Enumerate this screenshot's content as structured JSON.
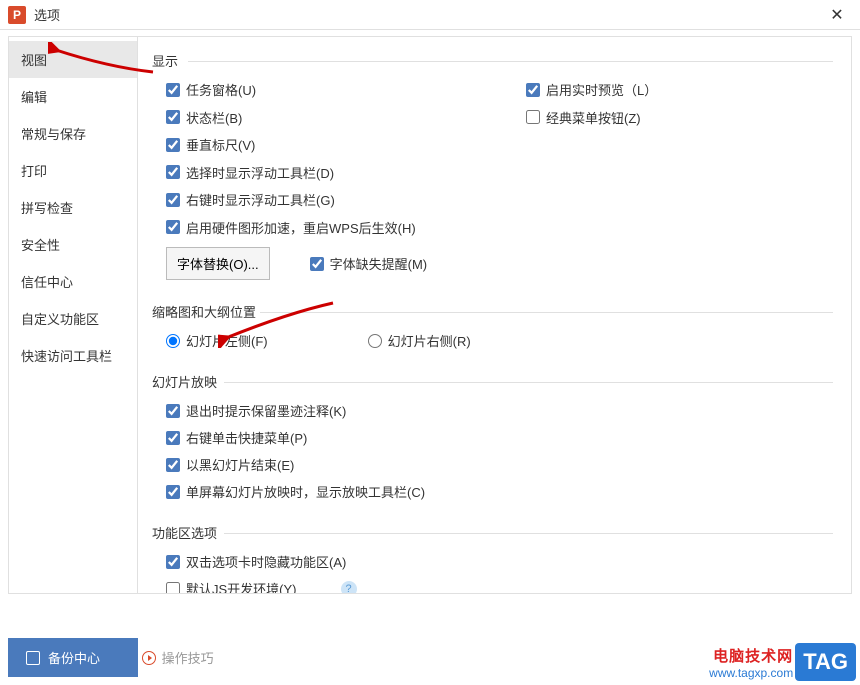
{
  "titlebar": {
    "app_letter": "P",
    "title": "选项",
    "close": "✕"
  },
  "sidebar": {
    "items": [
      {
        "label": "视图",
        "active": true
      },
      {
        "label": "编辑"
      },
      {
        "label": "常规与保存"
      },
      {
        "label": "打印"
      },
      {
        "label": "拼写检查"
      },
      {
        "label": "安全性"
      },
      {
        "label": "信任中心"
      },
      {
        "label": "自定义功能区"
      },
      {
        "label": "快速访问工具栏"
      }
    ]
  },
  "sections": {
    "display": {
      "title": "显示",
      "left": [
        {
          "label": "任务窗格(U)",
          "checked": true
        },
        {
          "label": "状态栏(B)",
          "checked": true
        },
        {
          "label": "垂直标尺(V)",
          "checked": true
        },
        {
          "label": "选择时显示浮动工具栏(D)",
          "checked": true
        },
        {
          "label": "右键时显示浮动工具栏(G)",
          "checked": true
        },
        {
          "label": "启用硬件图形加速，重启WPS后生效(H)",
          "checked": true
        }
      ],
      "right": [
        {
          "label": "启用实时预览（L）",
          "checked": true
        },
        {
          "label": "经典菜单按钮(Z)",
          "checked": false
        }
      ],
      "font_replace_btn": "字体替换(O)...",
      "font_missing": {
        "label": "字体缺失提醒(M)",
        "checked": true
      }
    },
    "thumbnail": {
      "title": "缩略图和大纲位置",
      "options": [
        {
          "label": "幻灯片左侧(F)",
          "value": "left",
          "checked": true
        },
        {
          "label": "幻灯片右侧(R)",
          "value": "right",
          "checked": false
        }
      ]
    },
    "slideshow": {
      "title": "幻灯片放映",
      "items": [
        {
          "label": "退出时提示保留墨迹注释(K)",
          "checked": true
        },
        {
          "label": "右键单击快捷菜单(P)",
          "checked": true
        },
        {
          "label": "以黑幻灯片结束(E)",
          "checked": true
        },
        {
          "label": "单屏幕幻灯片放映时，显示放映工具栏(C)",
          "checked": true
        }
      ]
    },
    "ribbon": {
      "title": "功能区选项",
      "items": [
        {
          "label": "双击选项卡时隐藏功能区(A)",
          "checked": true
        },
        {
          "label": "默认JS开发环境(Y)",
          "checked": false,
          "help": true
        }
      ]
    }
  },
  "footer": {
    "backup": "备份中心",
    "tips": "操作技巧"
  },
  "watermark": {
    "line1": "电脑技术网",
    "line2": "www.tagxp.com",
    "tag": "TAG"
  }
}
